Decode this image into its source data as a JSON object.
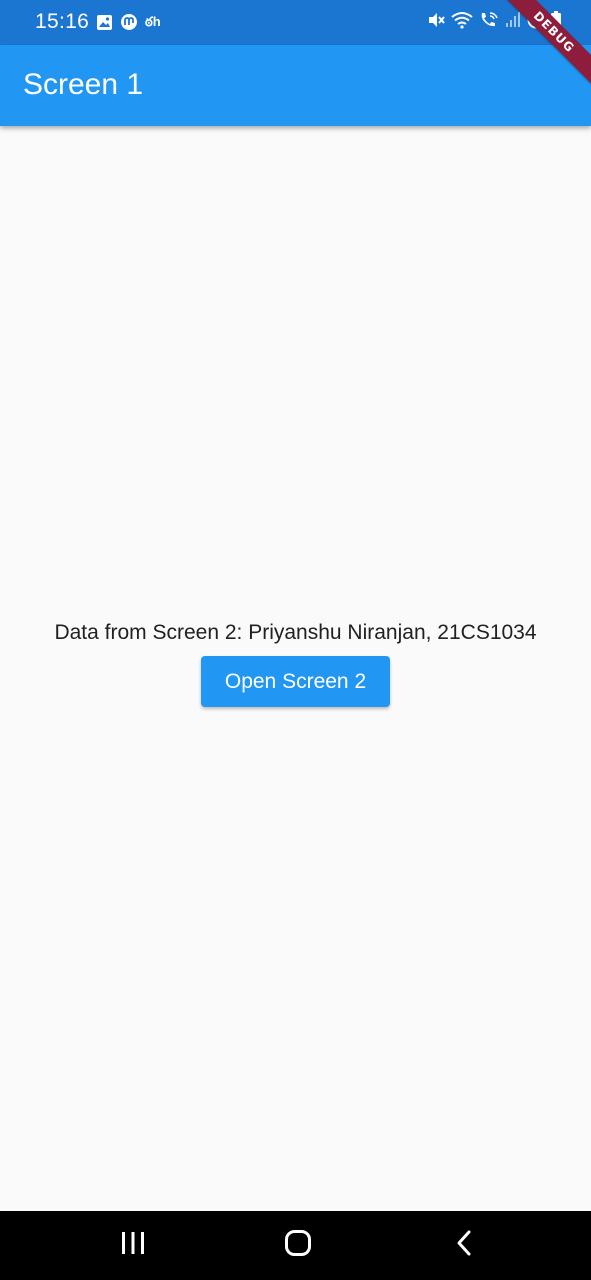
{
  "status_bar": {
    "time": "15:16",
    "carrier_glyph": "ఠh",
    "left_icons": [
      "image-icon",
      "notification-app-icon",
      "carrier-text-icon"
    ],
    "right_icons": [
      "mute-icon",
      "wifi-icon",
      "wifi-call-icon",
      "signal-icon",
      "do-not-disturb-icon",
      "battery-icon"
    ]
  },
  "debug_banner": {
    "label": "DEBUG"
  },
  "app_bar": {
    "title": "Screen 1"
  },
  "main": {
    "data_text": "Data from Screen 2: Priyanshu Niranjan, 21CS1034",
    "open_button_label": "Open Screen 2"
  },
  "nav_bar": {
    "buttons": [
      "recents-icon",
      "home-icon",
      "back-icon"
    ]
  },
  "colors": {
    "status_bar_bg": "#1b76d2",
    "app_bar_bg": "#2196f3",
    "button_bg": "#2196f3",
    "page_bg": "#fafafa",
    "debug_banner_bg": "#8e1c3b",
    "nav_bar_bg": "#000000"
  }
}
